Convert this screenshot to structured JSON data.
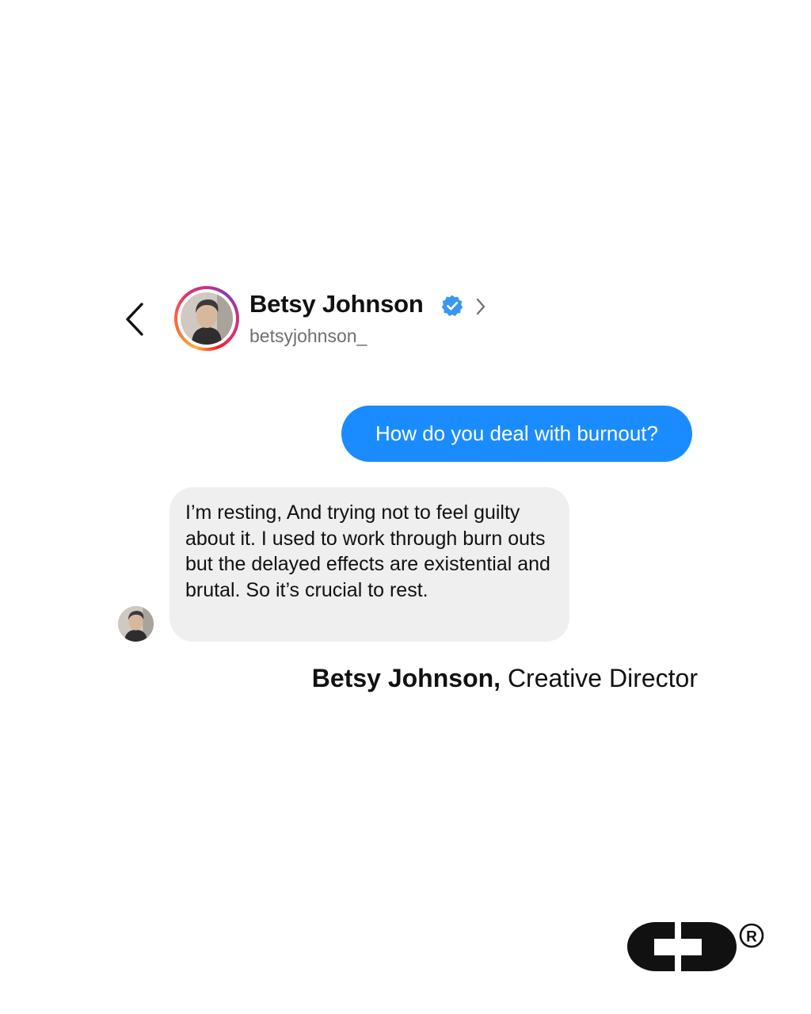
{
  "header": {
    "contact_name": "Betsy Johnson",
    "contact_handle": "betsyjohnson_",
    "verified": true
  },
  "messages": [
    {
      "direction": "outgoing",
      "text": "How do you deal with burnout?"
    },
    {
      "direction": "incoming",
      "text": "I’m resting, And trying not to feel guilty about it. I used to work through burn outs but the delayed effects are existential and brutal. So it’s crucial to rest."
    }
  ],
  "attribution": {
    "name": "Betsy Johnson,",
    "role": " Creative Director"
  },
  "colors": {
    "outgoing_bubble": "#1a8cff",
    "incoming_bubble": "#efefef",
    "verified_badge": "#3897f0",
    "handle_text": "#6e6e73"
  },
  "icons": {
    "back": "chevron-left-icon",
    "verified": "verified-badge-icon",
    "profile_link": "chevron-right-icon",
    "brand": "brand-logo"
  }
}
